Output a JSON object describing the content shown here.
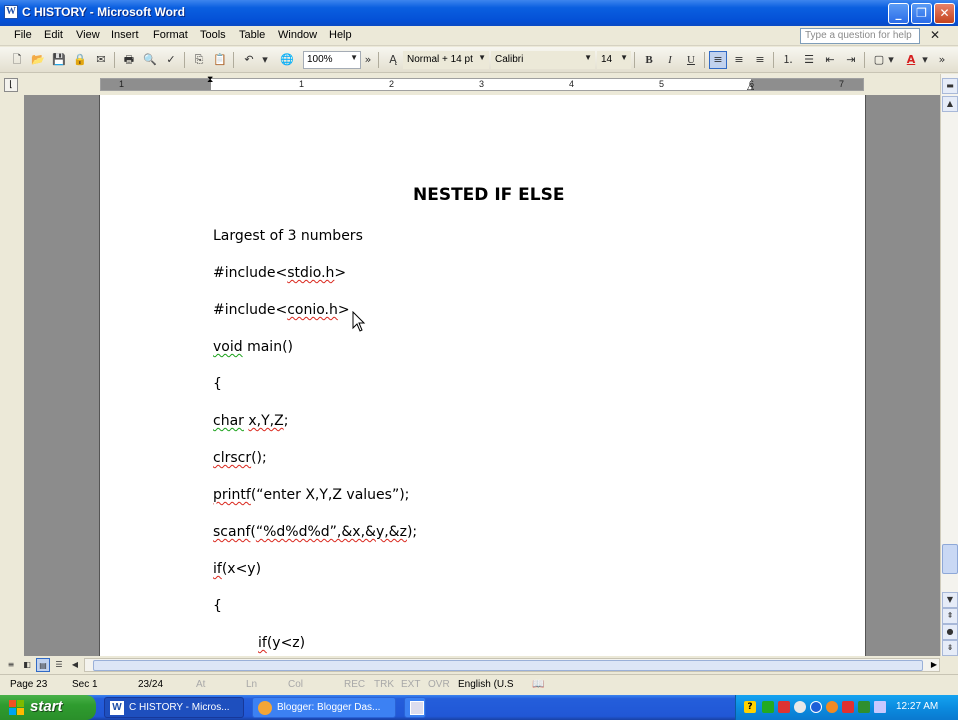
{
  "window": {
    "title": "C  HISTORY - Microsoft Word",
    "app_icon": "W"
  },
  "menu": [
    "File",
    "Edit",
    "View",
    "Insert",
    "Format",
    "Tools",
    "Table",
    "Window",
    "Help"
  ],
  "help_placeholder": "Type a question for help",
  "toolbar": {
    "zoom": "100%",
    "style": "Normal + 14 pt",
    "font": "Calibri",
    "size": "14",
    "bold": "B",
    "italic": "I",
    "underline": "U"
  },
  "ruler": {
    "numbers": [
      "1",
      "1",
      "2",
      "3",
      "4",
      "5",
      "6",
      "7"
    ]
  },
  "document": {
    "title": "NESTED IF ELSE",
    "lines": [
      "Largest of 3 numbers",
      "#include<stdio.h>",
      "#include<conio.h>",
      "void main()",
      "{",
      "char x,Y,Z;",
      "clrscr();",
      "printf(“enter X,Y,Z values”);",
      "scanf(“%d%d%d”,&x,&y,&z);",
      "if(x<y)",
      "{",
      "if(y<z)"
    ]
  },
  "status": {
    "page": "Page 23",
    "sec": "Sec 1",
    "pages": "23/24",
    "at": "At",
    "ln": "Ln",
    "col": "Col",
    "rec": "REC",
    "trk": "TRK",
    "ext": "EXT",
    "ovr": "OVR",
    "language": "English (U.S"
  },
  "taskbar": {
    "start": "start",
    "tasks": [
      "C  HISTORY - Micros...",
      "Blogger: Blogger Das..."
    ],
    "clock": "12:27 AM"
  },
  "colors": {
    "title_bar": "#0450d6",
    "spell_error": "#d9261c",
    "grammar_error": "#18a018",
    "start_green": "#2f9c2f"
  }
}
